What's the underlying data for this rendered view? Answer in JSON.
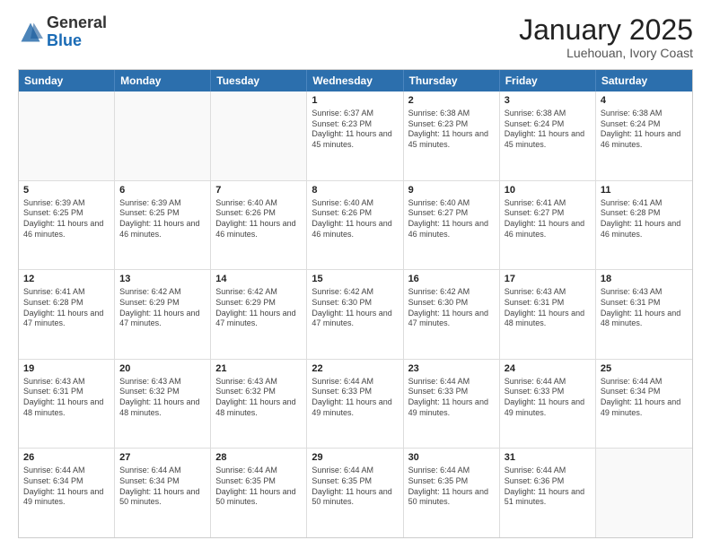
{
  "logo": {
    "general": "General",
    "blue": "Blue"
  },
  "header": {
    "month": "January 2025",
    "location": "Luehouan, Ivory Coast"
  },
  "weekdays": [
    "Sunday",
    "Monday",
    "Tuesday",
    "Wednesday",
    "Thursday",
    "Friday",
    "Saturday"
  ],
  "weeks": [
    [
      {
        "day": "",
        "sunrise": "",
        "sunset": "",
        "daylight": ""
      },
      {
        "day": "",
        "sunrise": "",
        "sunset": "",
        "daylight": ""
      },
      {
        "day": "",
        "sunrise": "",
        "sunset": "",
        "daylight": ""
      },
      {
        "day": "1",
        "sunrise": "Sunrise: 6:37 AM",
        "sunset": "Sunset: 6:23 PM",
        "daylight": "Daylight: 11 hours and 45 minutes."
      },
      {
        "day": "2",
        "sunrise": "Sunrise: 6:38 AM",
        "sunset": "Sunset: 6:23 PM",
        "daylight": "Daylight: 11 hours and 45 minutes."
      },
      {
        "day": "3",
        "sunrise": "Sunrise: 6:38 AM",
        "sunset": "Sunset: 6:24 PM",
        "daylight": "Daylight: 11 hours and 45 minutes."
      },
      {
        "day": "4",
        "sunrise": "Sunrise: 6:38 AM",
        "sunset": "Sunset: 6:24 PM",
        "daylight": "Daylight: 11 hours and 46 minutes."
      }
    ],
    [
      {
        "day": "5",
        "sunrise": "Sunrise: 6:39 AM",
        "sunset": "Sunset: 6:25 PM",
        "daylight": "Daylight: 11 hours and 46 minutes."
      },
      {
        "day": "6",
        "sunrise": "Sunrise: 6:39 AM",
        "sunset": "Sunset: 6:25 PM",
        "daylight": "Daylight: 11 hours and 46 minutes."
      },
      {
        "day": "7",
        "sunrise": "Sunrise: 6:40 AM",
        "sunset": "Sunset: 6:26 PM",
        "daylight": "Daylight: 11 hours and 46 minutes."
      },
      {
        "day": "8",
        "sunrise": "Sunrise: 6:40 AM",
        "sunset": "Sunset: 6:26 PM",
        "daylight": "Daylight: 11 hours and 46 minutes."
      },
      {
        "day": "9",
        "sunrise": "Sunrise: 6:40 AM",
        "sunset": "Sunset: 6:27 PM",
        "daylight": "Daylight: 11 hours and 46 minutes."
      },
      {
        "day": "10",
        "sunrise": "Sunrise: 6:41 AM",
        "sunset": "Sunset: 6:27 PM",
        "daylight": "Daylight: 11 hours and 46 minutes."
      },
      {
        "day": "11",
        "sunrise": "Sunrise: 6:41 AM",
        "sunset": "Sunset: 6:28 PM",
        "daylight": "Daylight: 11 hours and 46 minutes."
      }
    ],
    [
      {
        "day": "12",
        "sunrise": "Sunrise: 6:41 AM",
        "sunset": "Sunset: 6:28 PM",
        "daylight": "Daylight: 11 hours and 47 minutes."
      },
      {
        "day": "13",
        "sunrise": "Sunrise: 6:42 AM",
        "sunset": "Sunset: 6:29 PM",
        "daylight": "Daylight: 11 hours and 47 minutes."
      },
      {
        "day": "14",
        "sunrise": "Sunrise: 6:42 AM",
        "sunset": "Sunset: 6:29 PM",
        "daylight": "Daylight: 11 hours and 47 minutes."
      },
      {
        "day": "15",
        "sunrise": "Sunrise: 6:42 AM",
        "sunset": "Sunset: 6:30 PM",
        "daylight": "Daylight: 11 hours and 47 minutes."
      },
      {
        "day": "16",
        "sunrise": "Sunrise: 6:42 AM",
        "sunset": "Sunset: 6:30 PM",
        "daylight": "Daylight: 11 hours and 47 minutes."
      },
      {
        "day": "17",
        "sunrise": "Sunrise: 6:43 AM",
        "sunset": "Sunset: 6:31 PM",
        "daylight": "Daylight: 11 hours and 48 minutes."
      },
      {
        "day": "18",
        "sunrise": "Sunrise: 6:43 AM",
        "sunset": "Sunset: 6:31 PM",
        "daylight": "Daylight: 11 hours and 48 minutes."
      }
    ],
    [
      {
        "day": "19",
        "sunrise": "Sunrise: 6:43 AM",
        "sunset": "Sunset: 6:31 PM",
        "daylight": "Daylight: 11 hours and 48 minutes."
      },
      {
        "day": "20",
        "sunrise": "Sunrise: 6:43 AM",
        "sunset": "Sunset: 6:32 PM",
        "daylight": "Daylight: 11 hours and 48 minutes."
      },
      {
        "day": "21",
        "sunrise": "Sunrise: 6:43 AM",
        "sunset": "Sunset: 6:32 PM",
        "daylight": "Daylight: 11 hours and 48 minutes."
      },
      {
        "day": "22",
        "sunrise": "Sunrise: 6:44 AM",
        "sunset": "Sunset: 6:33 PM",
        "daylight": "Daylight: 11 hours and 49 minutes."
      },
      {
        "day": "23",
        "sunrise": "Sunrise: 6:44 AM",
        "sunset": "Sunset: 6:33 PM",
        "daylight": "Daylight: 11 hours and 49 minutes."
      },
      {
        "day": "24",
        "sunrise": "Sunrise: 6:44 AM",
        "sunset": "Sunset: 6:33 PM",
        "daylight": "Daylight: 11 hours and 49 minutes."
      },
      {
        "day": "25",
        "sunrise": "Sunrise: 6:44 AM",
        "sunset": "Sunset: 6:34 PM",
        "daylight": "Daylight: 11 hours and 49 minutes."
      }
    ],
    [
      {
        "day": "26",
        "sunrise": "Sunrise: 6:44 AM",
        "sunset": "Sunset: 6:34 PM",
        "daylight": "Daylight: 11 hours and 49 minutes."
      },
      {
        "day": "27",
        "sunrise": "Sunrise: 6:44 AM",
        "sunset": "Sunset: 6:34 PM",
        "daylight": "Daylight: 11 hours and 50 minutes."
      },
      {
        "day": "28",
        "sunrise": "Sunrise: 6:44 AM",
        "sunset": "Sunset: 6:35 PM",
        "daylight": "Daylight: 11 hours and 50 minutes."
      },
      {
        "day": "29",
        "sunrise": "Sunrise: 6:44 AM",
        "sunset": "Sunset: 6:35 PM",
        "daylight": "Daylight: 11 hours and 50 minutes."
      },
      {
        "day": "30",
        "sunrise": "Sunrise: 6:44 AM",
        "sunset": "Sunset: 6:35 PM",
        "daylight": "Daylight: 11 hours and 50 minutes."
      },
      {
        "day": "31",
        "sunrise": "Sunrise: 6:44 AM",
        "sunset": "Sunset: 6:36 PM",
        "daylight": "Daylight: 11 hours and 51 minutes."
      },
      {
        "day": "",
        "sunrise": "",
        "sunset": "",
        "daylight": ""
      }
    ]
  ]
}
